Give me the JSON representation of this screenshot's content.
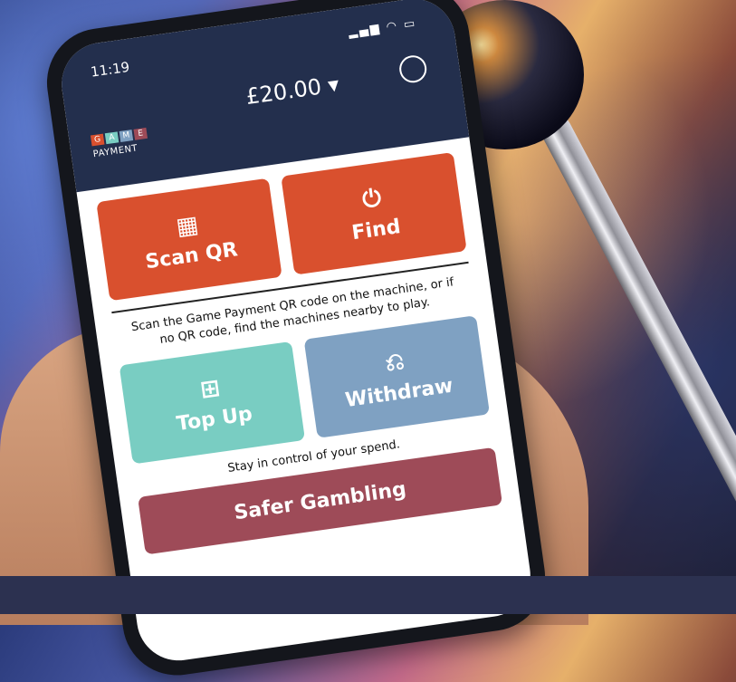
{
  "status": {
    "time": "11:19"
  },
  "header": {
    "balance": "£20.00 ▾"
  },
  "logo": {
    "letters": [
      "G",
      "A",
      "M",
      "E"
    ],
    "text": "PAYMENT"
  },
  "actions": {
    "scan_label": "Scan QR",
    "find_label": "Find",
    "hint": "Scan the Game Payment QR code on the machine, or if no QR code, find the machines nearby to play.",
    "topup_label": "Top Up",
    "withdraw_label": "Withdraw"
  },
  "footer": {
    "spend_text": "Stay in control of your spend.",
    "safer_label": "Safer Gambling"
  },
  "colors": {
    "header": "#232f4d",
    "scan": "#d9502e",
    "topup": "#79cdc2",
    "withdraw": "#7fa1c2",
    "safer": "#9e4b58"
  }
}
